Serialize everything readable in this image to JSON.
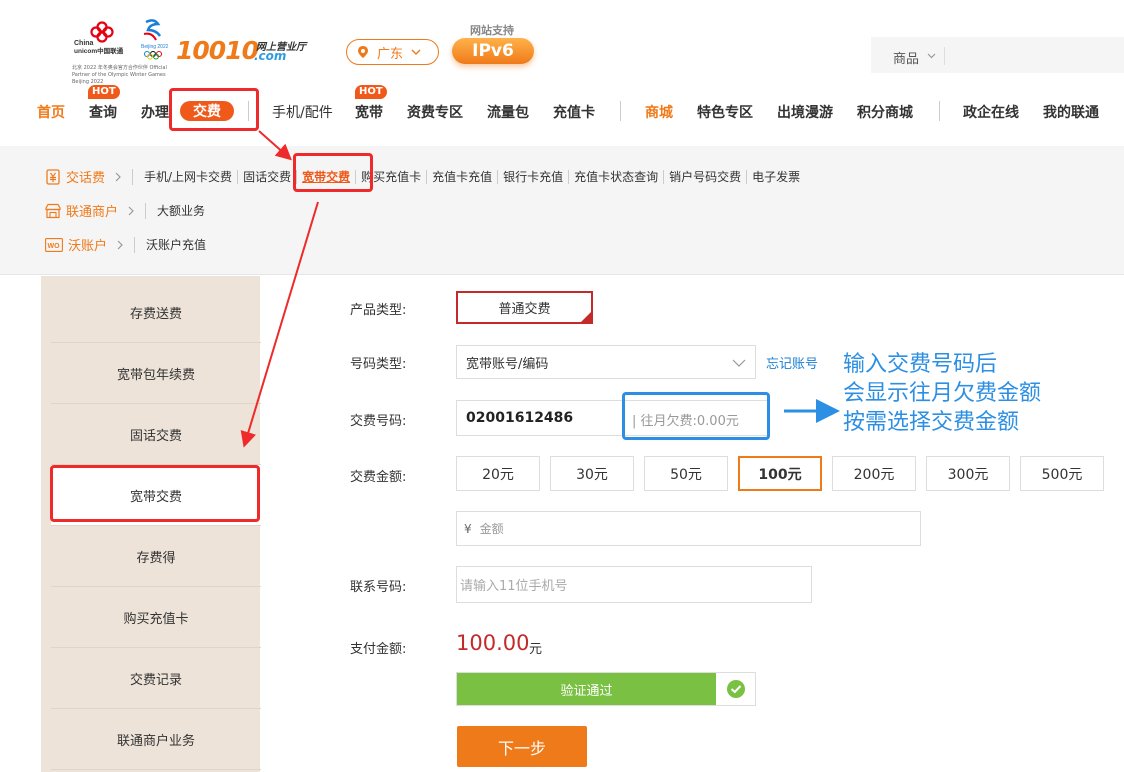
{
  "header": {
    "logo_main": "10010",
    "logo_sub1": "网上营业厅",
    "logo_sub2": ".com",
    "logo_note": "北京 2022 年冬奥会官方合作伙伴 Official Partner of the Olympic Winter Games Beijing 2022",
    "region": "广东",
    "ipv6_support": "网站支持",
    "ipv6_label": "IPv6",
    "search_category": "商品"
  },
  "nav": {
    "items": [
      "首页",
      "查询",
      "办理",
      "交费",
      "手机/配件",
      "宽带",
      "资费专区",
      "流量包",
      "充值卡",
      "商城",
      "特色专区",
      "出境漫游",
      "积分商城",
      "政企在线",
      "我的联通"
    ],
    "hot": "HOT"
  },
  "submenu": {
    "rows": [
      {
        "category": "交话费",
        "links": [
          "手机/上网卡交费",
          "固话交费",
          "宽带交费",
          "购买充值卡",
          "充值卡充值",
          "银行卡充值",
          "充值卡状态查询",
          "销户号码交费",
          "电子发票"
        ]
      },
      {
        "category": "联通商户",
        "links": [
          "大额业务"
        ]
      },
      {
        "category": "沃账户",
        "links": [
          "沃账户充值"
        ]
      }
    ],
    "wo_icon_text": "WO"
  },
  "sidebar": {
    "items": [
      "存费送费",
      "宽带包年续费",
      "固话交费",
      "宽带交费",
      "存费得",
      "购买充值卡",
      "交费记录",
      "联通商户业务"
    ]
  },
  "form": {
    "product_type_label": "产品类型:",
    "product_type_value": "普通交费",
    "number_type_label": "号码类型:",
    "number_type_value": "宽带账号/编码",
    "forgot_account": "忘记账号",
    "pay_number_label": "交费号码:",
    "pay_number_value": "02001612486",
    "arrears": "| 往月欠费:0.00元",
    "amount_label": "交费金额:",
    "amounts": [
      "20元",
      "30元",
      "50元",
      "100元",
      "200元",
      "300元",
      "500元"
    ],
    "selected_amount": "100元",
    "custom_amount_prefix": "¥",
    "custom_amount_placeholder": "金额",
    "contact_label": "联系号码:",
    "contact_placeholder": "请输入11位手机号",
    "pay_amount_label": "支付金额:",
    "pay_amount_value": "100.00",
    "pay_amount_unit": "元",
    "verify_text": "验证通过",
    "next_button": "下一步"
  },
  "annotation": {
    "lines": [
      "输入交费号码后",
      "会显示往月欠费金额",
      "按需选择交费金额"
    ],
    "red_color": "#ee2a2a",
    "blue_color": "#2d8fe3"
  },
  "colors": {
    "brand_orange": "#ef7a1a",
    "verify_green": "#7ac143",
    "amount_red": "#c32a2a"
  }
}
